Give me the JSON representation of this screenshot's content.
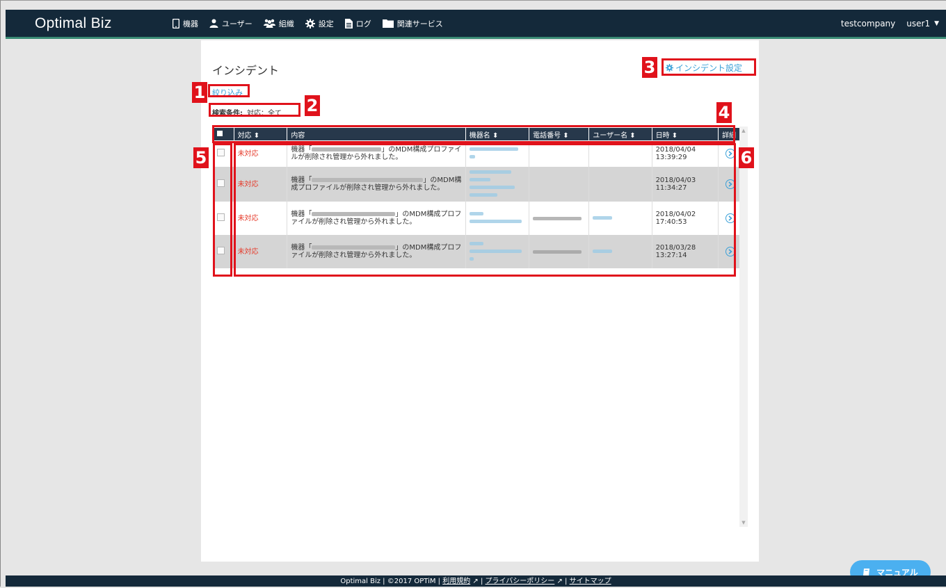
{
  "header": {
    "brand": "Optimal Biz",
    "nav": [
      {
        "label": "機器",
        "icon": "phone-icon"
      },
      {
        "label": "ユーザー",
        "icon": "user-icon"
      },
      {
        "label": "組織",
        "icon": "group-icon"
      },
      {
        "label": "設定",
        "icon": "gear-icon"
      },
      {
        "label": "ログ",
        "icon": "document-icon"
      },
      {
        "label": "関連サービス",
        "icon": "folder-icon"
      }
    ],
    "company": "testcompany",
    "user": "user1"
  },
  "page": {
    "title": "インシデント",
    "settings_link": "インシデント設定",
    "filter_link": "絞り込み",
    "search_label": "検索条件:",
    "search_value": "対応：全て"
  },
  "table": {
    "columns": [
      "対応 ⬍",
      "内容",
      "機器名 ⬍",
      "電話番号 ⬍",
      "ユーザー名 ⬍",
      "日時 ⬍",
      "詳細"
    ],
    "rows": [
      {
        "status": "未対応",
        "content_prefix": "機器「",
        "content_suffix": "」のMDM構成プロファイルが削除され管理から外れました。",
        "date": "2018/04/04",
        "time": "13:39:29"
      },
      {
        "status": "未対応",
        "content_prefix": "機器「",
        "content_suffix": "」のMDM構成プロファイルが削除され管理から外れました。",
        "date": "2018/04/03",
        "time": "11:34:27"
      },
      {
        "status": "未対応",
        "content_prefix": "機器「",
        "content_suffix": "」のMDM構成プロファイルが削除され管理から外れました。",
        "date": "2018/04/02",
        "time": "17:40:53"
      },
      {
        "status": "未対応",
        "content_prefix": "機器「",
        "content_suffix": "」のMDM構成プロファイルが削除され管理から外れました。",
        "date": "2018/03/28",
        "time": "13:27:14"
      }
    ]
  },
  "annotations": [
    "1",
    "2",
    "3",
    "4",
    "5",
    "6"
  ],
  "footer": {
    "copyright": "Optimal Biz | ©2017 OPTiM | ",
    "terms": "利用規約",
    "privacy": "プライバシーポリシー",
    "sitemap": "サイトマップ",
    "sep": " | "
  },
  "manual_button": "マニュアル",
  "colors": {
    "header_bg": "#14293a",
    "accent_line": "#3a8a74",
    "link": "#3aa0d8",
    "status_unhandled": "#e53a2a",
    "annotation": "#e0121b",
    "manual_btn": "#4bb0f0"
  }
}
